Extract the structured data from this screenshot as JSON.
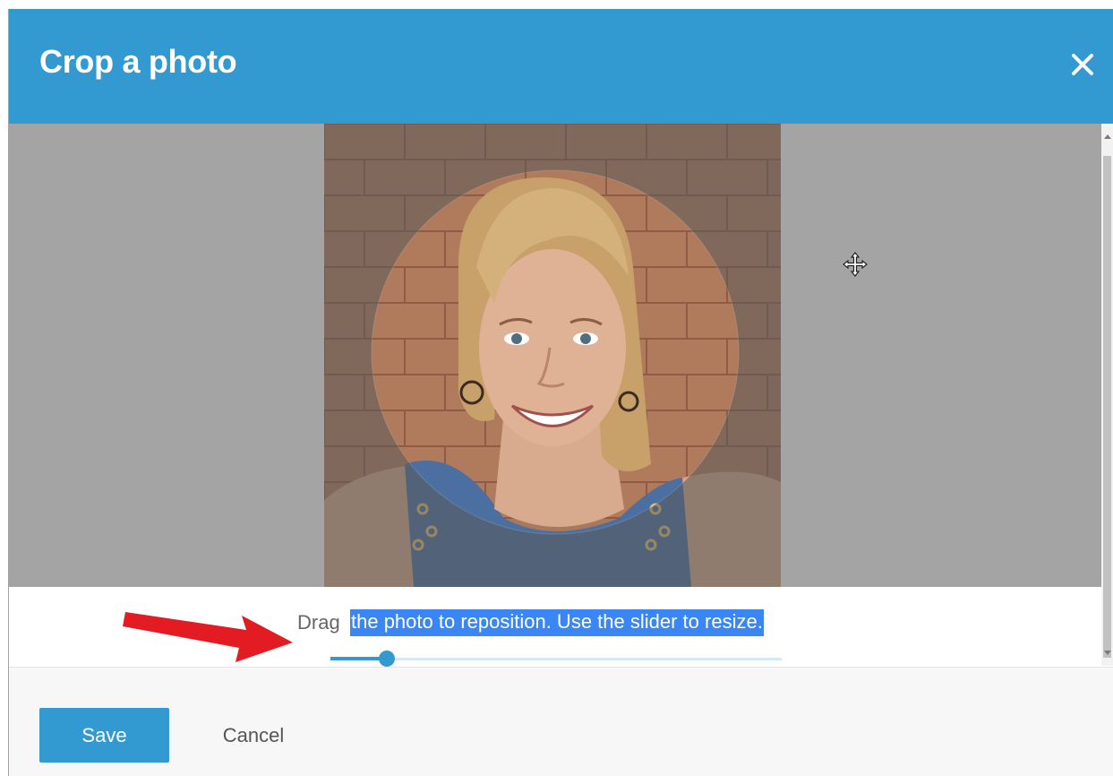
{
  "dialog": {
    "title": "Crop a photo"
  },
  "crop": {
    "instruction_plain": "Drag",
    "instruction_selected": "the photo to reposition. Use the slider to resize."
  },
  "slider": {
    "value_fraction": 0.125
  },
  "footer": {
    "save_label": "Save",
    "cancel_label": "Cancel"
  },
  "colors": {
    "accent": "#339ad1",
    "selection": "#3a86f5",
    "crop_backdrop": "#a4a4a4",
    "annotation_arrow": "#e31b23"
  },
  "icons": {
    "close": "close-icon",
    "cursor": "move-cursor-icon",
    "annotation": "red-arrow-annotation"
  }
}
